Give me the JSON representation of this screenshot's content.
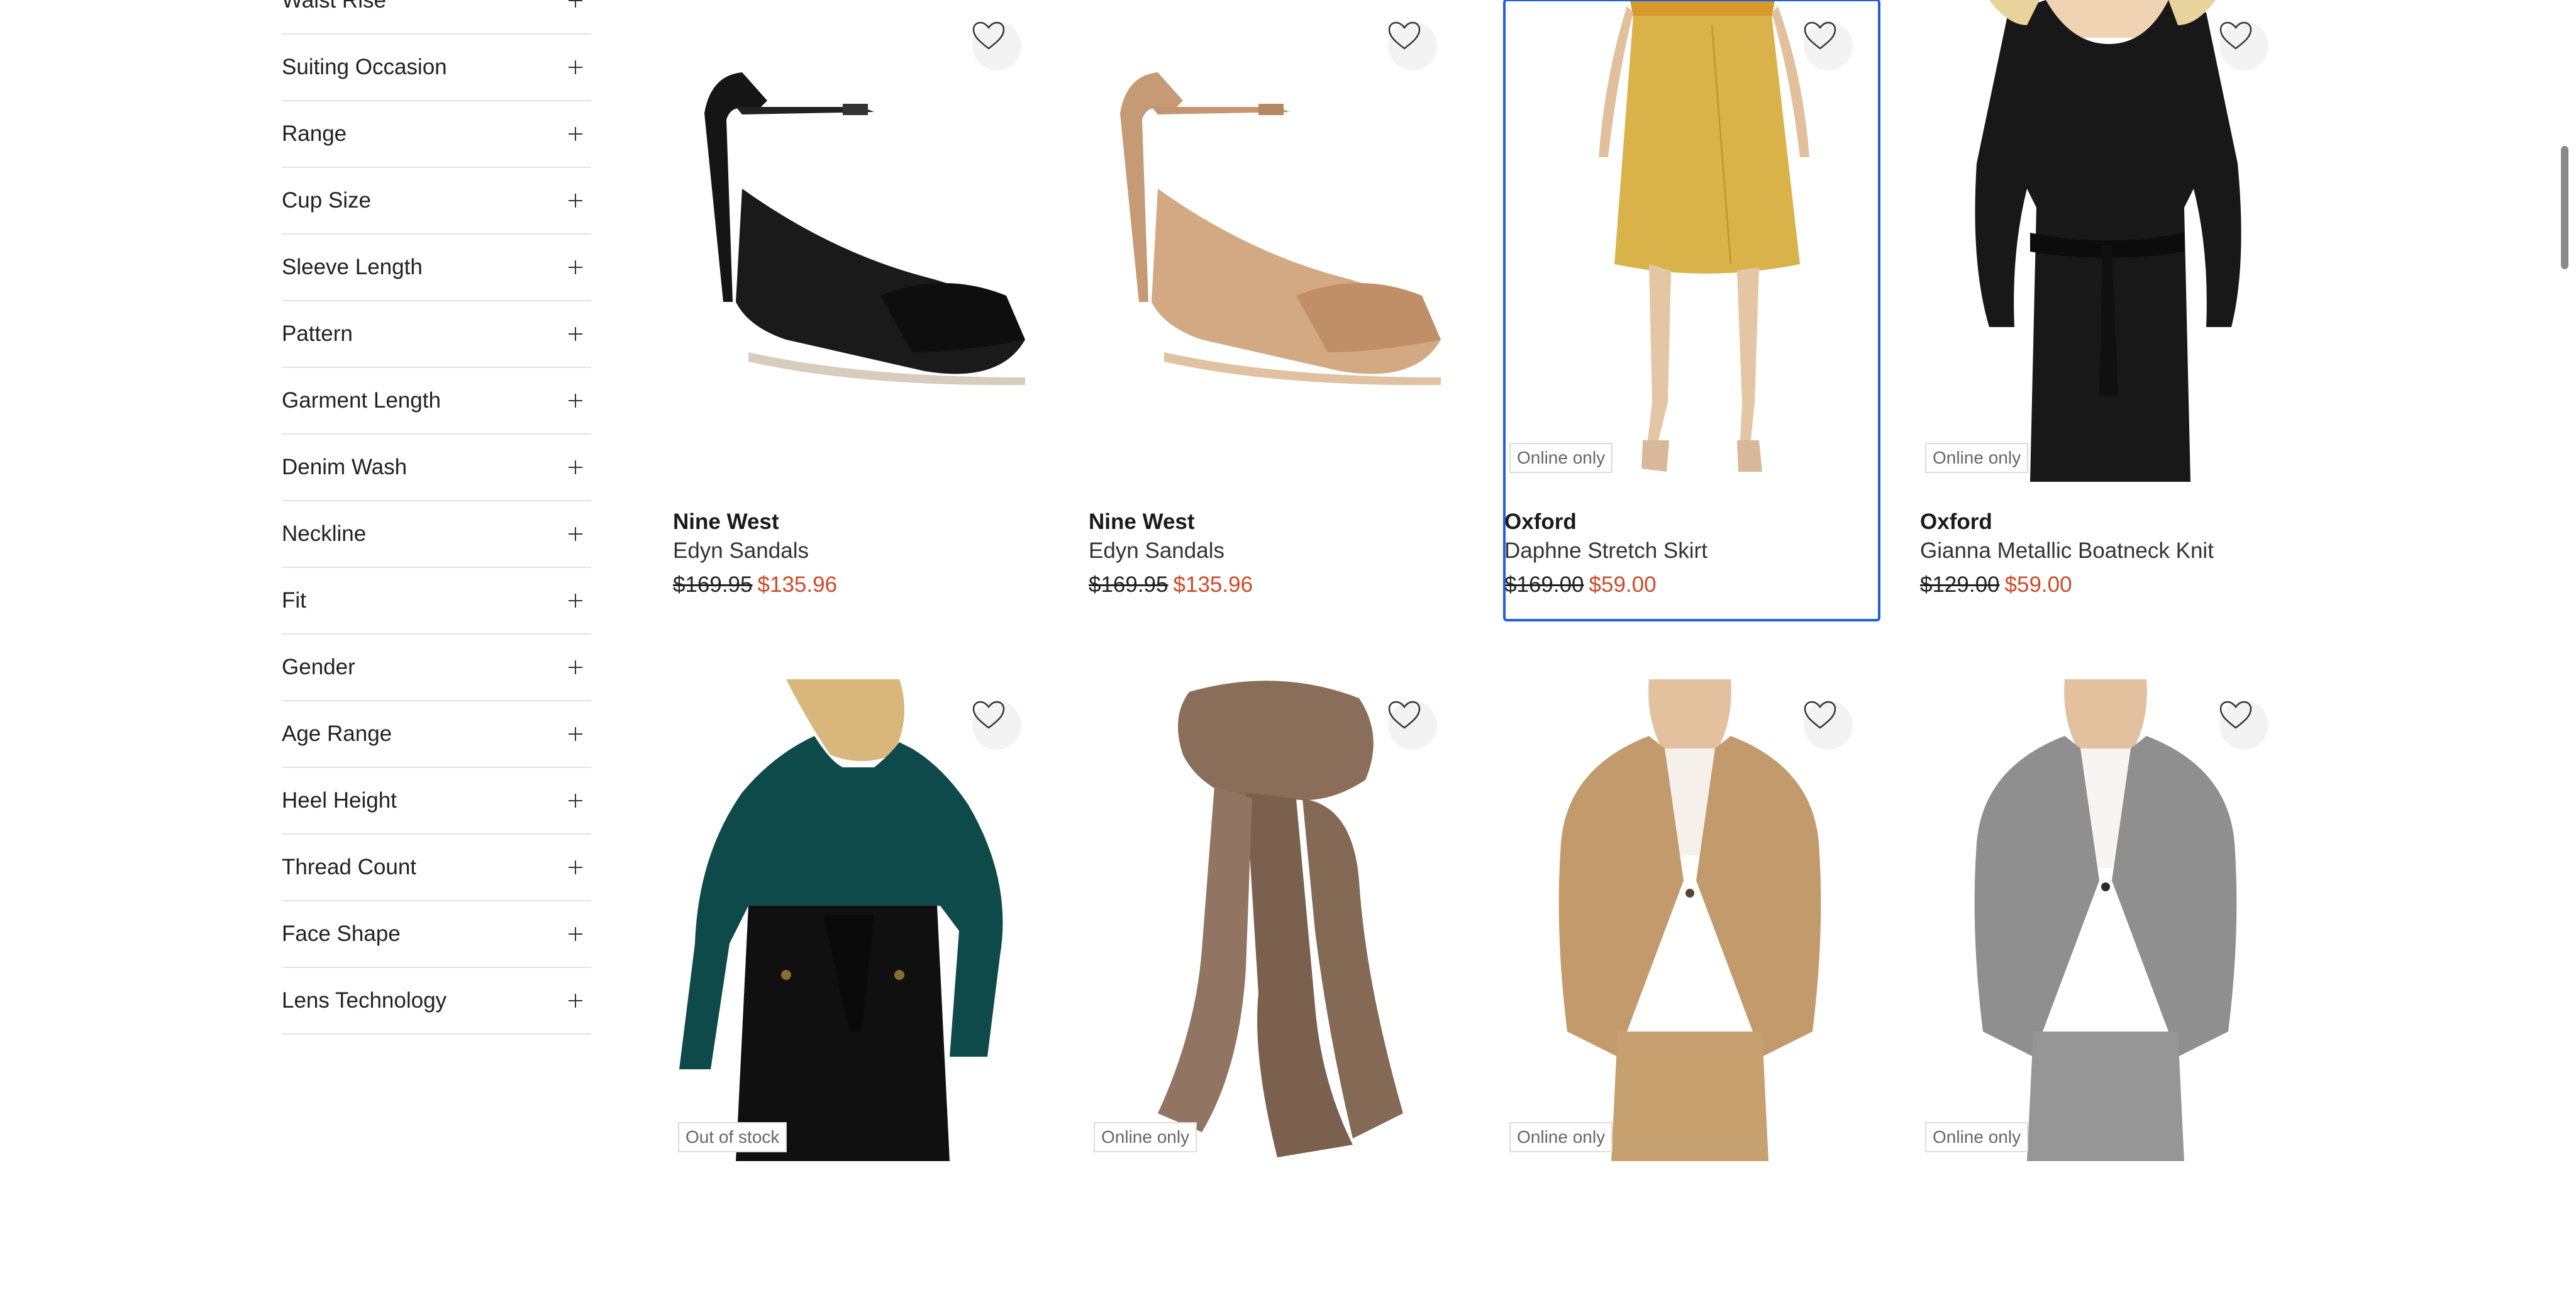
{
  "filters": [
    "Waist Rise",
    "Suiting Occasion",
    "Range",
    "Cup Size",
    "Sleeve Length",
    "Pattern",
    "Garment Length",
    "Denim Wash",
    "Neckline",
    "Fit",
    "Gender",
    "Age Range",
    "Heel Height",
    "Thread Count",
    "Face Shape",
    "Lens Technology"
  ],
  "products": [
    {
      "brand": "Nine West",
      "name": "Edyn Sandals",
      "was": "$169.95",
      "now": "$135.96",
      "badge": ""
    },
    {
      "brand": "Nine West",
      "name": "Edyn Sandals",
      "was": "$169.95",
      "now": "$135.96",
      "badge": ""
    },
    {
      "brand": "Oxford",
      "name": "Daphne Stretch Skirt",
      "was": "$169.00",
      "now": "$59.00",
      "badge": "Online only"
    },
    {
      "brand": "Oxford",
      "name": "Gianna Metallic Boatneck Knit",
      "was": "$129.00",
      "now": "$59.00",
      "badge": "Online only"
    },
    {
      "badge": "Out of stock"
    },
    {
      "badge": "Online only"
    },
    {
      "badge": "Online only"
    },
    {
      "badge": "Online only"
    }
  ],
  "colors": {
    "sale_price": "#d04a26",
    "selected_outline": "#1f5fd8"
  }
}
